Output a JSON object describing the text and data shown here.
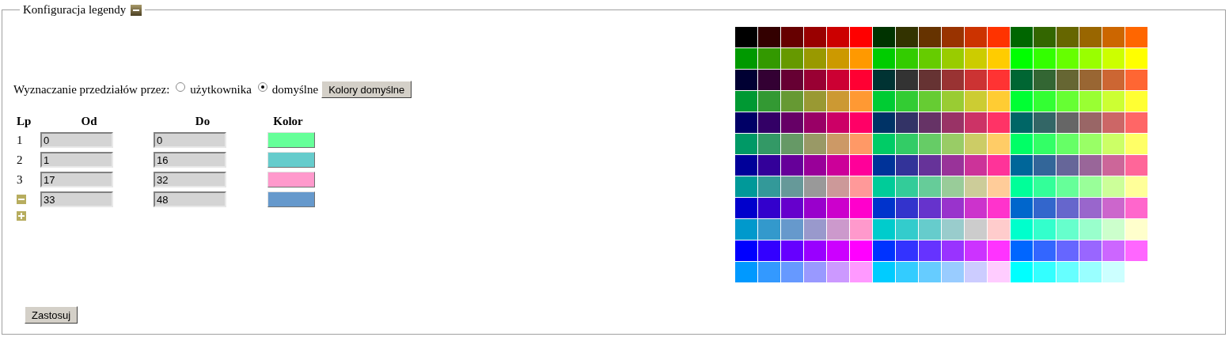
{
  "legend": {
    "title": "Konfiguracja legendy",
    "expanded": true
  },
  "interval_mode": {
    "label": "Wyznaczanie przedziałów przez:",
    "options": [
      {
        "label": "użytkownika",
        "selected": false
      },
      {
        "label": "domyślne",
        "selected": true
      }
    ],
    "button": "Kolory domyślne"
  },
  "table": {
    "columns": [
      "Lp",
      "Od",
      "Do",
      "Kolor"
    ],
    "rows": [
      {
        "kind": "numbered",
        "lp": "1",
        "from": "0",
        "to": "0",
        "color": "#66ff99"
      },
      {
        "kind": "numbered",
        "lp": "2",
        "from": "1",
        "to": "16",
        "color": "#66cccc"
      },
      {
        "kind": "numbered",
        "lp": "3",
        "from": "17",
        "to": "32",
        "color": "#ff99cc"
      },
      {
        "kind": "removable",
        "from": "33",
        "to": "48",
        "color": "#6699cc"
      }
    ]
  },
  "apply_button": "Zastosuj",
  "palette": [
    [
      {
        "color": "#000000"
      },
      {
        "color": "#330000"
      },
      {
        "color": "#660000"
      },
      {
        "color": "#990000"
      },
      {
        "color": "#cc0000"
      },
      {
        "color": "#ff0000"
      },
      {
        "color": "#003300"
      },
      {
        "color": "#333300"
      },
      {
        "color": "#663300"
      },
      {
        "color": "#993300"
      },
      {
        "color": "#cc3300"
      },
      {
        "color": "#ff3300"
      },
      {
        "color": "#006600"
      },
      {
        "color": "#336600"
      },
      {
        "color": "#666600"
      },
      {
        "color": "#996600"
      },
      {
        "color": "#cc6600"
      },
      {
        "color": "#ff6600"
      }
    ],
    [
      {
        "color": "#009900"
      },
      {
        "color": "#339900"
      },
      {
        "color": "#669900"
      },
      {
        "color": "#999900"
      },
      {
        "color": "#cc9900"
      },
      {
        "color": "#ff9900"
      },
      {
        "color": "#00cc00"
      },
      {
        "color": "#33cc00"
      },
      {
        "color": "#66cc00"
      },
      {
        "color": "#99cc00"
      },
      {
        "color": "#cccc00"
      },
      {
        "color": "#ffcc00"
      },
      {
        "color": "#00ff00"
      },
      {
        "color": "#33ff00"
      },
      {
        "color": "#66ff00"
      },
      {
        "color": "#99ff00"
      },
      {
        "color": "#ccff00"
      },
      {
        "color": "#ffff00"
      }
    ],
    [
      {
        "color": "#000033"
      },
      {
        "color": "#330033"
      },
      {
        "color": "#660033"
      },
      {
        "color": "#990033"
      },
      {
        "color": "#cc0033"
      },
      {
        "color": "#ff0033"
      },
      {
        "color": "#003333"
      },
      {
        "color": "#333333"
      },
      {
        "color": "#663333"
      },
      {
        "color": "#993333"
      },
      {
        "color": "#cc3333"
      },
      {
        "color": "#ff3333"
      },
      {
        "color": "#006633"
      },
      {
        "color": "#336633"
      },
      {
        "color": "#666633"
      },
      {
        "color": "#996633"
      },
      {
        "color": "#cc6633"
      },
      {
        "color": "#ff6633"
      }
    ],
    [
      {
        "color": "#009933"
      },
      {
        "color": "#339933"
      },
      {
        "color": "#669933"
      },
      {
        "color": "#999933"
      },
      {
        "color": "#cc9933"
      },
      {
        "color": "#ff9933"
      },
      {
        "color": "#00cc33"
      },
      {
        "color": "#33cc33"
      },
      {
        "color": "#66cc33"
      },
      {
        "color": "#99cc33"
      },
      {
        "color": "#cccc33"
      },
      {
        "color": "#ffcc33"
      },
      {
        "color": "#00ff33"
      },
      {
        "color": "#33ff33"
      },
      {
        "color": "#66ff33"
      },
      {
        "color": "#99ff33"
      },
      {
        "color": "#ccff33"
      },
      {
        "color": "#ffff33"
      }
    ],
    [
      {
        "color": "#000066"
      },
      {
        "color": "#330066"
      },
      {
        "color": "#660066"
      },
      {
        "color": "#990066"
      },
      {
        "color": "#cc0066"
      },
      {
        "color": "#ff0066"
      },
      {
        "color": "#003366"
      },
      {
        "color": "#333366"
      },
      {
        "color": "#663366"
      },
      {
        "color": "#993366"
      },
      {
        "color": "#cc3366"
      },
      {
        "color": "#ff3366"
      },
      {
        "color": "#006666"
      },
      {
        "color": "#336666"
      },
      {
        "color": "#666666"
      },
      {
        "color": "#996666"
      },
      {
        "color": "#cc6666"
      },
      {
        "color": "#ff6666"
      }
    ],
    [
      {
        "color": "#009966"
      },
      {
        "color": "#339966"
      },
      {
        "color": "#669966"
      },
      {
        "color": "#999966"
      },
      {
        "color": "#cc9966"
      },
      {
        "color": "#ff9966"
      },
      {
        "color": "#00cc66"
      },
      {
        "color": "#33cc66"
      },
      {
        "color": "#66cc66"
      },
      {
        "color": "#99cc66"
      },
      {
        "color": "#cccc66"
      },
      {
        "color": "#ffcc66"
      },
      {
        "color": "#00ff66"
      },
      {
        "color": "#33ff66"
      },
      {
        "color": "#66ff66"
      },
      {
        "color": "#99ff66"
      },
      {
        "color": "#ccff66"
      },
      {
        "color": "#ffff66"
      }
    ],
    [
      {
        "color": "#000099"
      },
      {
        "color": "#330099"
      },
      {
        "color": "#660099"
      },
      {
        "color": "#990099"
      },
      {
        "color": "#cc0099"
      },
      {
        "color": "#ff0099"
      },
      {
        "color": "#003399"
      },
      {
        "color": "#333399"
      },
      {
        "color": "#663399"
      },
      {
        "color": "#993399"
      },
      {
        "color": "#cc3399"
      },
      {
        "color": "#ff3399"
      },
      {
        "color": "#006699"
      },
      {
        "color": "#336699"
      },
      {
        "color": "#666699"
      },
      {
        "color": "#996699"
      },
      {
        "color": "#cc6699"
      },
      {
        "color": "#ff6699"
      }
    ],
    [
      {
        "color": "#009999"
      },
      {
        "color": "#339999"
      },
      {
        "color": "#669999"
      },
      {
        "color": "#999999"
      },
      {
        "color": "#cc9999"
      },
      {
        "color": "#ff9999"
      },
      {
        "color": "#00cc99"
      },
      {
        "color": "#33cc99"
      },
      {
        "color": "#66cc99"
      },
      {
        "color": "#99cc99"
      },
      {
        "color": "#cccc99"
      },
      {
        "color": "#ffcc99"
      },
      {
        "color": "#00ff99"
      },
      {
        "color": "#33ff99"
      },
      {
        "color": "#66ff99"
      },
      {
        "color": "#99ff99"
      },
      {
        "color": "#ccff99"
      },
      {
        "color": "#ffff99"
      }
    ],
    [
      {
        "color": "#0000cc"
      },
      {
        "color": "#3300cc"
      },
      {
        "color": "#6600cc"
      },
      {
        "color": "#9900cc"
      },
      {
        "color": "#cc00cc"
      },
      {
        "color": "#ff00cc"
      },
      {
        "color": "#0033cc"
      },
      {
        "color": "#3333cc"
      },
      {
        "color": "#6633cc"
      },
      {
        "color": "#9933cc"
      },
      {
        "color": "#cc33cc"
      },
      {
        "color": "#ff33cc"
      },
      {
        "color": "#0066cc"
      },
      {
        "color": "#3366cc"
      },
      {
        "color": "#6666cc"
      },
      {
        "color": "#9966cc"
      },
      {
        "color": "#cc66cc"
      },
      {
        "color": "#ff66cc"
      }
    ],
    [
      {
        "color": "#0099cc"
      },
      {
        "color": "#3399cc"
      },
      {
        "color": "#6699cc"
      },
      {
        "color": "#9999cc"
      },
      {
        "color": "#cc99cc"
      },
      {
        "color": "#ff99cc"
      },
      {
        "color": "#00cccc"
      },
      {
        "color": "#33cccc"
      },
      {
        "color": "#66cccc"
      },
      {
        "color": "#99cccc"
      },
      {
        "color": "#cccccc"
      },
      {
        "color": "#ffcccc"
      },
      {
        "color": "#00ffcc"
      },
      {
        "color": "#33ffcc"
      },
      {
        "color": "#66ffcc"
      },
      {
        "color": "#99ffcc"
      },
      {
        "color": "#ccffcc"
      },
      {
        "color": "#ffffcc"
      }
    ],
    [
      {
        "color": "#0000ff"
      },
      {
        "color": "#3300ff"
      },
      {
        "color": "#6600ff"
      },
      {
        "color": "#9900ff"
      },
      {
        "color": "#cc00ff"
      },
      {
        "color": "#ff00ff"
      },
      {
        "color": "#0033ff"
      },
      {
        "color": "#3333ff"
      },
      {
        "color": "#6633ff"
      },
      {
        "color": "#9933ff"
      },
      {
        "color": "#cc33ff"
      },
      {
        "color": "#ff33ff"
      },
      {
        "color": "#0066ff"
      },
      {
        "color": "#3366ff"
      },
      {
        "color": "#6666ff"
      },
      {
        "color": "#9966ff"
      },
      {
        "color": "#cc66ff"
      },
      {
        "color": "#ff66ff"
      }
    ],
    [
      {
        "color": "#0099ff"
      },
      {
        "color": "#3399ff"
      },
      {
        "color": "#6699ff"
      },
      {
        "color": "#9999ff"
      },
      {
        "color": "#cc99ff"
      },
      {
        "color": "#ff99ff"
      },
      {
        "color": "#00ccff"
      },
      {
        "color": "#33ccff"
      },
      {
        "color": "#66ccff"
      },
      {
        "color": "#99ccff"
      },
      {
        "color": "#ccccff"
      },
      {
        "color": "#ffccff"
      },
      {
        "color": "#00ffff"
      },
      {
        "color": "#33ffff"
      },
      {
        "color": "#66ffff"
      },
      {
        "color": "#99ffff"
      },
      {
        "color": "#ccffff"
      }
    ]
  ]
}
